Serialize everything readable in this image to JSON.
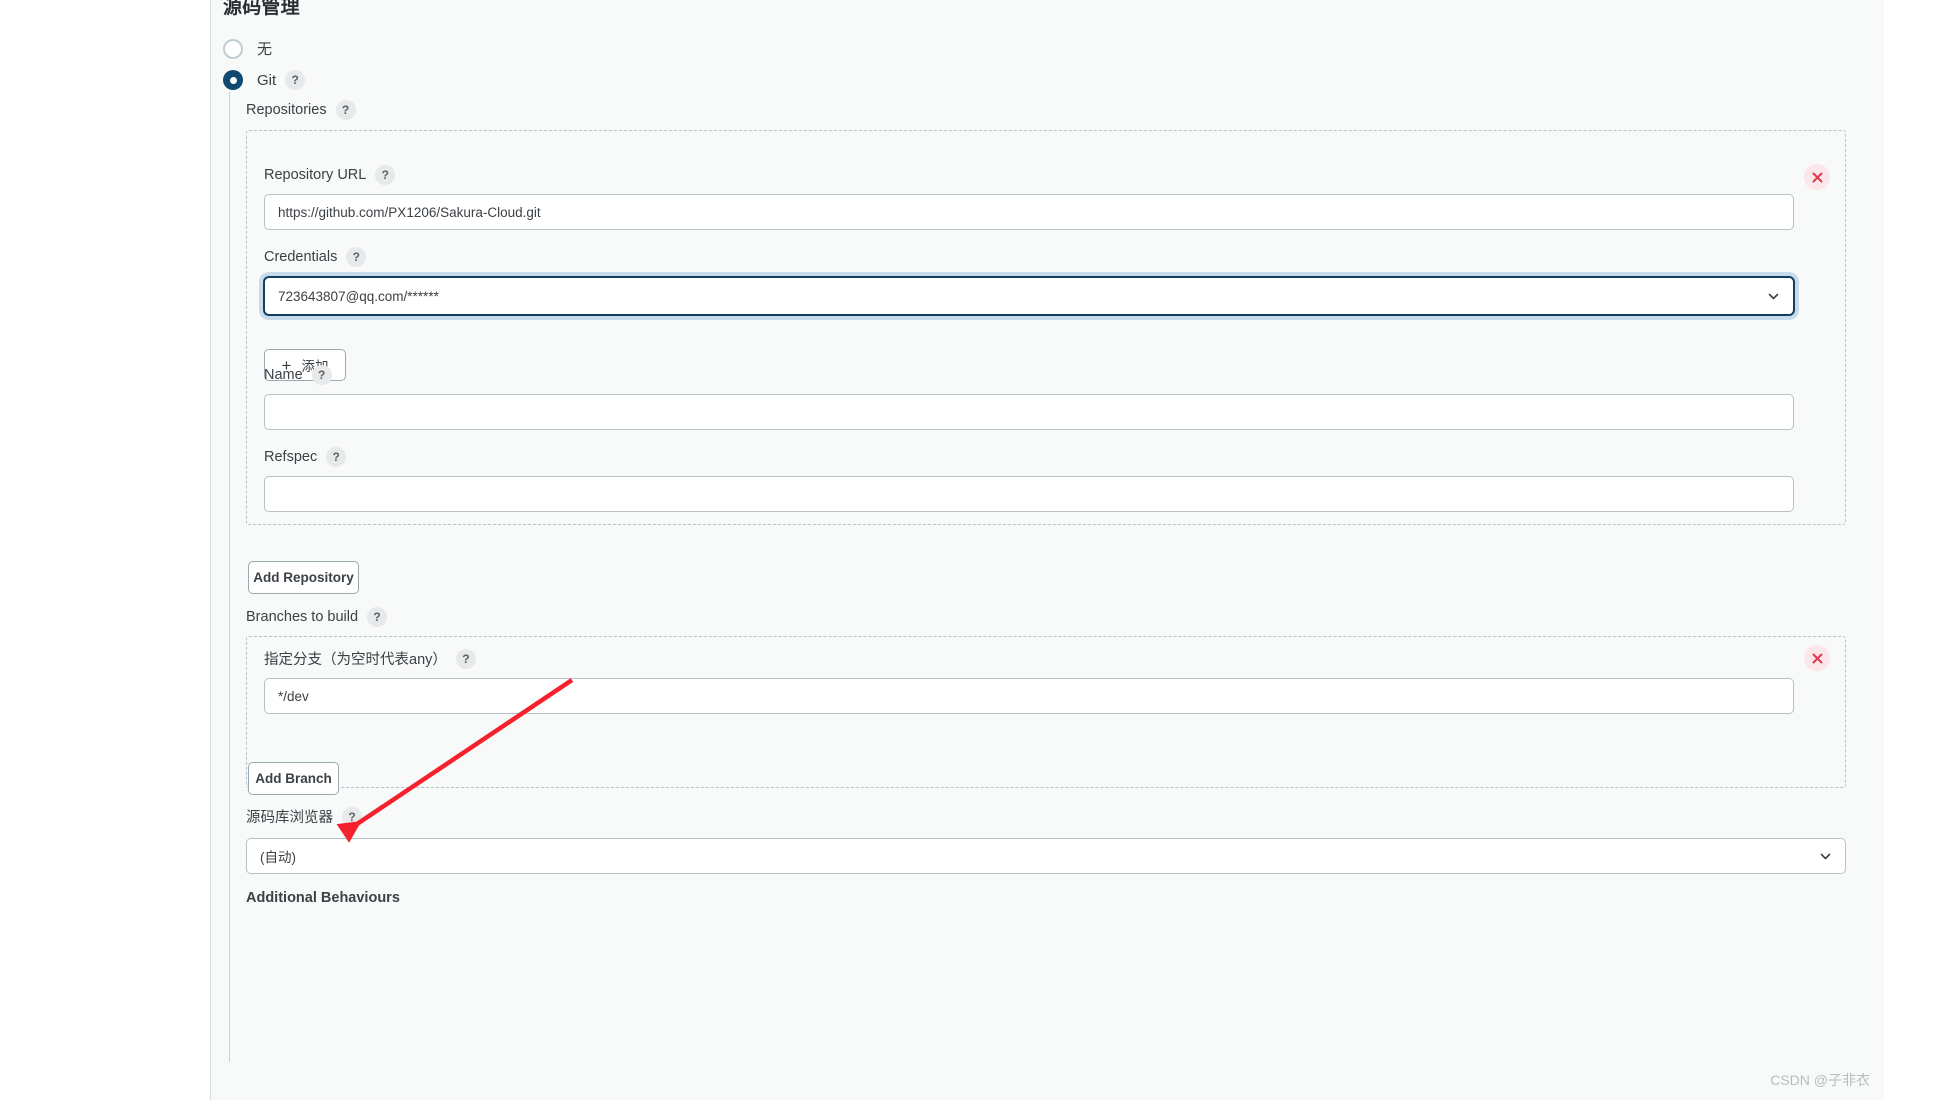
{
  "page": {
    "title": "源码管理",
    "watermark": "CSDN @子非衣"
  },
  "scm_options": [
    {
      "label": "无",
      "selected": false,
      "has_help": false
    },
    {
      "label": "Git",
      "selected": true,
      "has_help": true
    }
  ],
  "repositories": {
    "section_label": "Repositories",
    "help": "?",
    "repository_url": {
      "label": "Repository URL",
      "value": "https://github.com/PX1206/Sakura-Cloud.git",
      "help": "?"
    },
    "credentials": {
      "label": "Credentials",
      "value": "723643807@qq.com/******",
      "help": "?",
      "add_button": "添加",
      "add_icon": "plus-icon"
    },
    "name": {
      "label": "Name",
      "value": "",
      "help": "?"
    },
    "refspec": {
      "label": "Refspec",
      "value": "",
      "help": "?"
    },
    "delete_icon": "close-icon",
    "add_repository_button": "Add Repository"
  },
  "branches": {
    "section_label": "Branches to build",
    "help": "?",
    "branch_specifier": {
      "label": "指定分支（为空时代表any）",
      "value": "*/dev",
      "help": "?"
    },
    "delete_icon": "close-icon",
    "add_branch_button": "Add Branch"
  },
  "repository_browser": {
    "label": "源码库浏览器",
    "help": "?",
    "value": "(自动)",
    "chevron_icon": "chevron-down-icon"
  },
  "additional_behaviours": {
    "label": "Additional Behaviours"
  },
  "colors": {
    "accent": "#104a70",
    "panel_bg": "#f8f9f9",
    "border": "#b7c2c8",
    "danger": "#e03a4e",
    "annotation": "#f5222d"
  }
}
